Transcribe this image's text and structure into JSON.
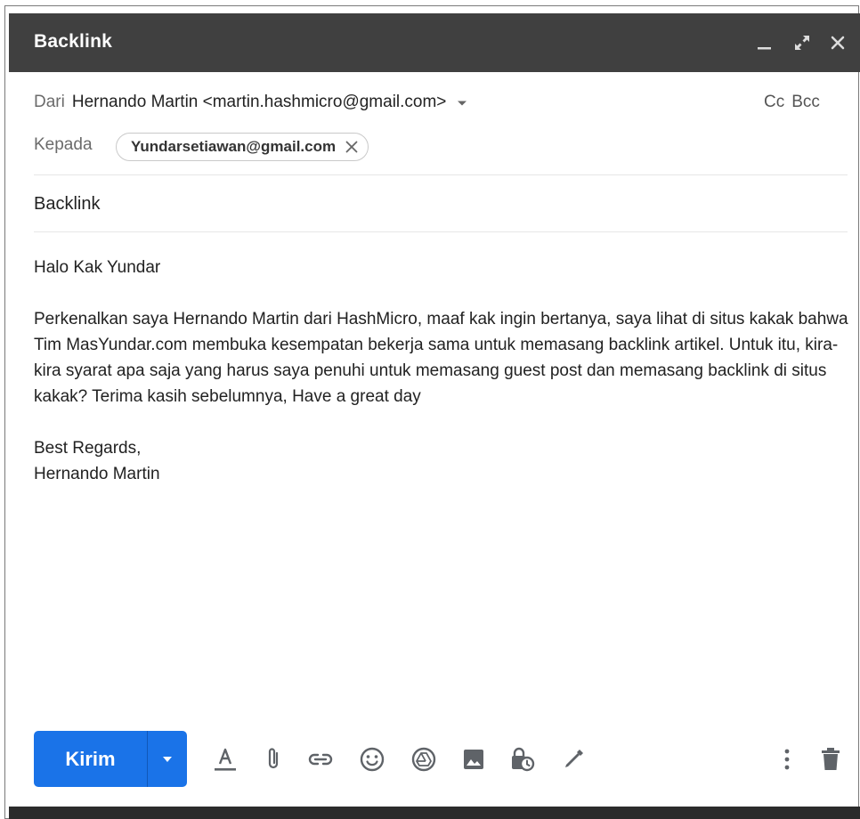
{
  "window": {
    "title": "Backlink"
  },
  "compose": {
    "from_label": "Dari",
    "from_value": "Hernando Martin <martin.hashmicro@gmail.com>",
    "cc_label": "Cc",
    "bcc_label": "Bcc",
    "to_label": "Kepada",
    "recipients": [
      "Yundarsetiawan@gmail.com"
    ],
    "subject": "Backlink",
    "body": {
      "greeting": "Halo Kak Yundar",
      "paragraph": "Perkenalkan saya Hernando Martin dari HashMicro, maaf kak ingin bertanya, saya lihat di situs kakak bahwa Tim MasYundar.com membuka kesempatan bekerja sama untuk memasang backlink artikel. Untuk itu, kira-kira syarat apa saja yang harus saya penuhi untuk memasang guest post dan memasang backlink di situs kakak? Terima kasih sebelumnya, Have a great day",
      "closing": "Best Regards,",
      "signature": "Hernando Martin"
    }
  },
  "toolbar": {
    "send_label": "Kirim",
    "icons": [
      "format-text-icon",
      "attach-icon",
      "link-icon",
      "emoji-icon",
      "drive-icon",
      "photo-icon",
      "confidential-mode-icon",
      "signature-icon",
      "more-options-icon",
      "discard-icon"
    ]
  },
  "colors": {
    "header_bg": "#404040",
    "send_button": "#1a73e8",
    "icon_gray": "#5f6368"
  }
}
